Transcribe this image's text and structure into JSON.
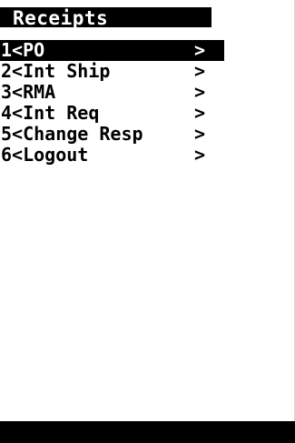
{
  "header": {
    "title": "Receipts"
  },
  "menu": {
    "items": [
      {
        "label": "1<PO",
        "arrow": ">",
        "selected": true
      },
      {
        "label": "2<Int Ship",
        "arrow": ">",
        "selected": false
      },
      {
        "label": "3<RMA",
        "arrow": ">",
        "selected": false
      },
      {
        "label": "4<Int Req",
        "arrow": ">",
        "selected": false
      },
      {
        "label": "5<Change Resp",
        "arrow": ">",
        "selected": false
      },
      {
        "label": "6<Logout",
        "arrow": ">",
        "selected": false
      }
    ]
  },
  "colors": {
    "background": "#ffffff",
    "highlight": "#000000",
    "highlight_text": "#ffffff"
  }
}
